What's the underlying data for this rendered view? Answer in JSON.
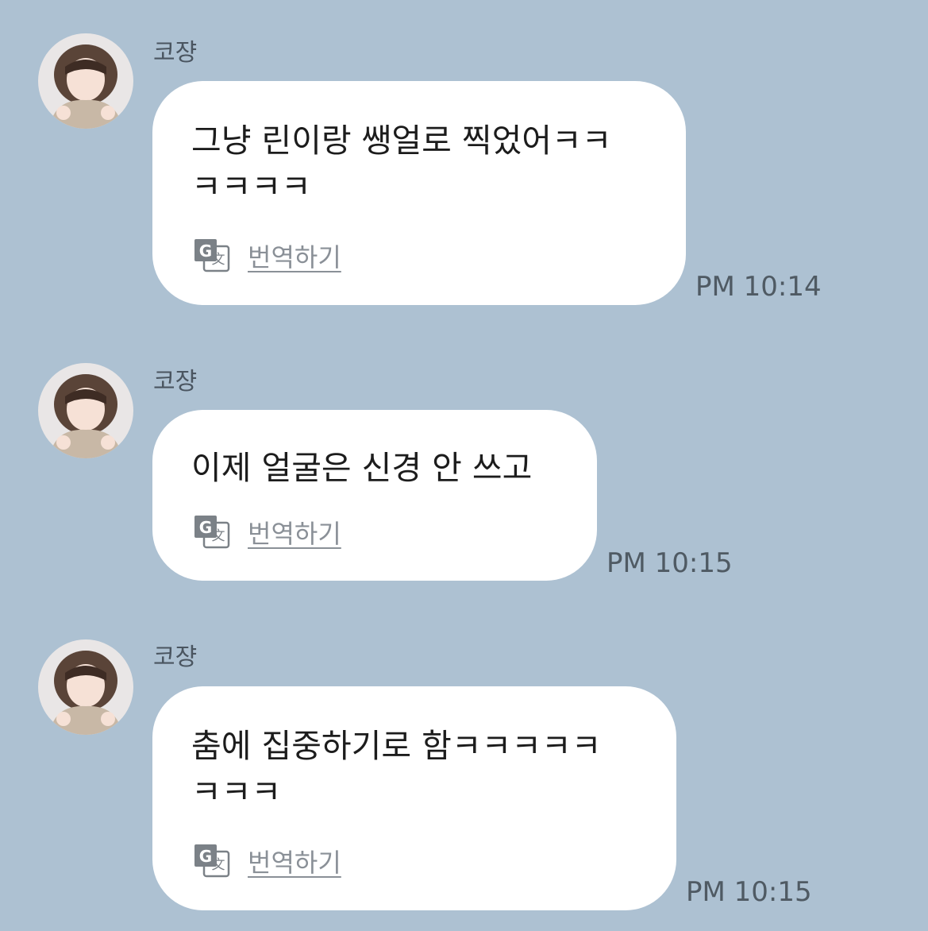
{
  "messages": [
    {
      "sender": "코쟝",
      "avatar_icon": "profile-photo",
      "lines": [
        "그냥 린이랑 쌩얼로 찍었어ㅋㅋ",
        "ㅋㅋㅋㅋ"
      ],
      "translate_label": "번역하기",
      "translate_icon": "google-translate-icon",
      "time": "PM 10:14"
    },
    {
      "sender": "코쟝",
      "avatar_icon": "profile-photo",
      "lines": [
        "이제 얼굴은 신경 안 쓰고"
      ],
      "translate_label": "번역하기",
      "translate_icon": "google-translate-icon",
      "time": "PM 10:15"
    },
    {
      "sender": "코쟝",
      "avatar_icon": "profile-photo",
      "lines": [
        "춤에 집중하기로 함ㅋㅋㅋㅋㅋ",
        "ㅋㅋㅋ"
      ],
      "translate_label": "번역하기",
      "translate_icon": "google-translate-icon",
      "time": "PM 10:15"
    }
  ],
  "colors": {
    "background": "#adc1d2",
    "bubble": "#ffffff",
    "text": "#1c1c1c",
    "timestamp": "#4f5a63",
    "translate_link": "#8a9097"
  }
}
